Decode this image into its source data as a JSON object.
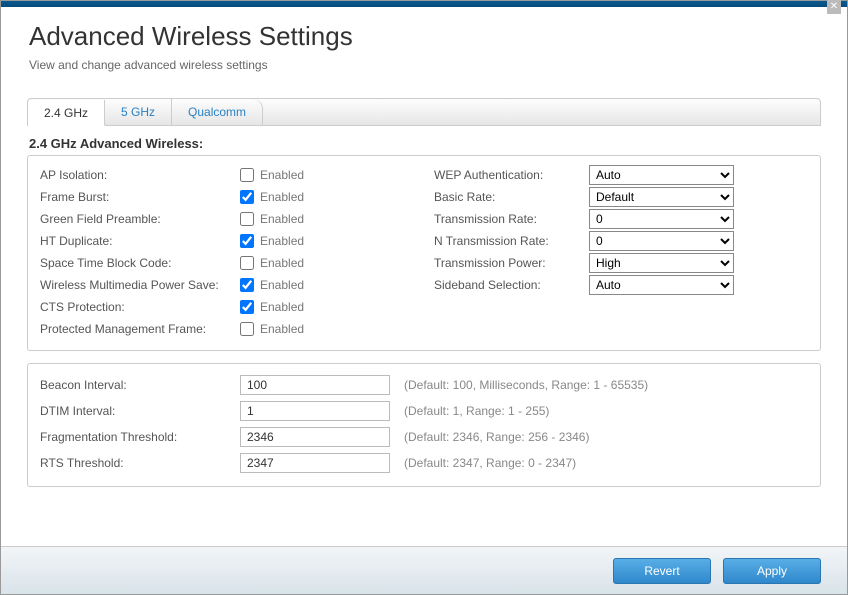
{
  "header": {
    "title": "Advanced Wireless Settings",
    "subtitle": "View and change advanced wireless settings"
  },
  "tabs": {
    "t24": "2.4 GHz",
    "t5": "5 GHz",
    "qc": "Qualcomm"
  },
  "section_title": "2.4 GHz Advanced Wireless:",
  "enabled_label": "Enabled",
  "left_checks": [
    {
      "label": "AP Isolation:",
      "checked": false
    },
    {
      "label": "Frame Burst:",
      "checked": true
    },
    {
      "label": "Green Field Preamble:",
      "checked": false
    },
    {
      "label": "HT Duplicate:",
      "checked": true
    },
    {
      "label": "Space Time Block Code:",
      "checked": false
    },
    {
      "label": "Wireless Multimedia Power Save:",
      "checked": true
    },
    {
      "label": "CTS Protection:",
      "checked": true
    },
    {
      "label": "Protected Management Frame:",
      "checked": false
    }
  ],
  "right_selects": [
    {
      "label": "WEP Authentication:",
      "value": "Auto"
    },
    {
      "label": "Basic Rate:",
      "value": "Default"
    },
    {
      "label": "Transmission Rate:",
      "value": "0"
    },
    {
      "label": "N Transmission Rate:",
      "value": "0"
    },
    {
      "label": "Transmission Power:",
      "value": "High"
    },
    {
      "label": "Sideband Selection:",
      "value": "Auto"
    }
  ],
  "num_fields": [
    {
      "label": "Beacon Interval:",
      "value": "100",
      "hint": "(Default: 100, Milliseconds, Range: 1 - 65535)"
    },
    {
      "label": "DTIM Interval:",
      "value": "1",
      "hint": "(Default: 1, Range: 1 - 255)"
    },
    {
      "label": "Fragmentation Threshold:",
      "value": "2346",
      "hint": "(Default: 2346, Range: 256 - 2346)"
    },
    {
      "label": "RTS Threshold:",
      "value": "2347",
      "hint": "(Default: 2347, Range: 0 - 2347)"
    }
  ],
  "footer": {
    "revert": "Revert",
    "apply": "Apply"
  },
  "close": "✕"
}
